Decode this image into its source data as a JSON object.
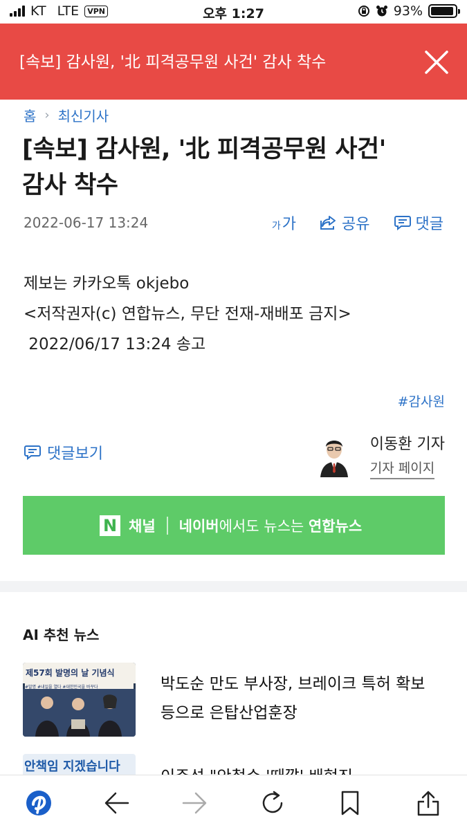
{
  "status_bar": {
    "carrier": "KT",
    "network": "LTE",
    "vpn": "VPN",
    "time": "오후 1:27",
    "battery_percent": "93%",
    "battery_level": 0.93
  },
  "banner": {
    "text": "[속보] 감사원, '北 피격공무원 사건' 감사 착수",
    "color": "#e84a45"
  },
  "breadcrumb": {
    "home": "홈",
    "section": "최신기사"
  },
  "article": {
    "title_line1": "[속보] 감사원, '北 피격공무원 사건'",
    "title_line2": "감사 착수",
    "date": "2022-06-17 13:24",
    "tools": {
      "font_small": "가",
      "font_large": "가",
      "share": "공유",
      "comment": "댓글"
    },
    "body_line1": "제보는 카카오톡 okjebo",
    "body_line2": "<저작권자(c) 연합뉴스, 무단 전재-재배포 금지>",
    "body_line3": " 2022/06/17 13:24 송고",
    "tag": "#감사원",
    "view_comments": "댓글보기",
    "reporter_name": "이동환 기자",
    "reporter_page": "기자 페이지"
  },
  "naver_banner": {
    "logo": "N",
    "channel": "채널",
    "text_bold1": "네이버",
    "text_mid": "에서도 뉴스는 ",
    "text_bold2": "연합뉴스",
    "color": "#5ecb68"
  },
  "ai_news": {
    "heading": "AI 추천 뉴스",
    "items": [
      {
        "headline_line1": "박도순 만도 부사장, 브레이크 특허 확보",
        "headline_line2": "등으로 은탑산업훈장",
        "thumb_caption": "제57회 발명의 날 기념식",
        "thumb_sub": "#발명 #내일을 열다 #대한민국을 바꾸다"
      },
      {
        "headline_line1": "이주석 \"안철수 '때깔' 배현진",
        "thumb_caption": "안책임 지겠습니다"
      }
    ]
  },
  "bottom_bar": {
    "icons": [
      "yonhap-logo-icon",
      "back-icon",
      "forward-icon",
      "reload-icon",
      "bookmark-icon",
      "share-icon"
    ]
  }
}
